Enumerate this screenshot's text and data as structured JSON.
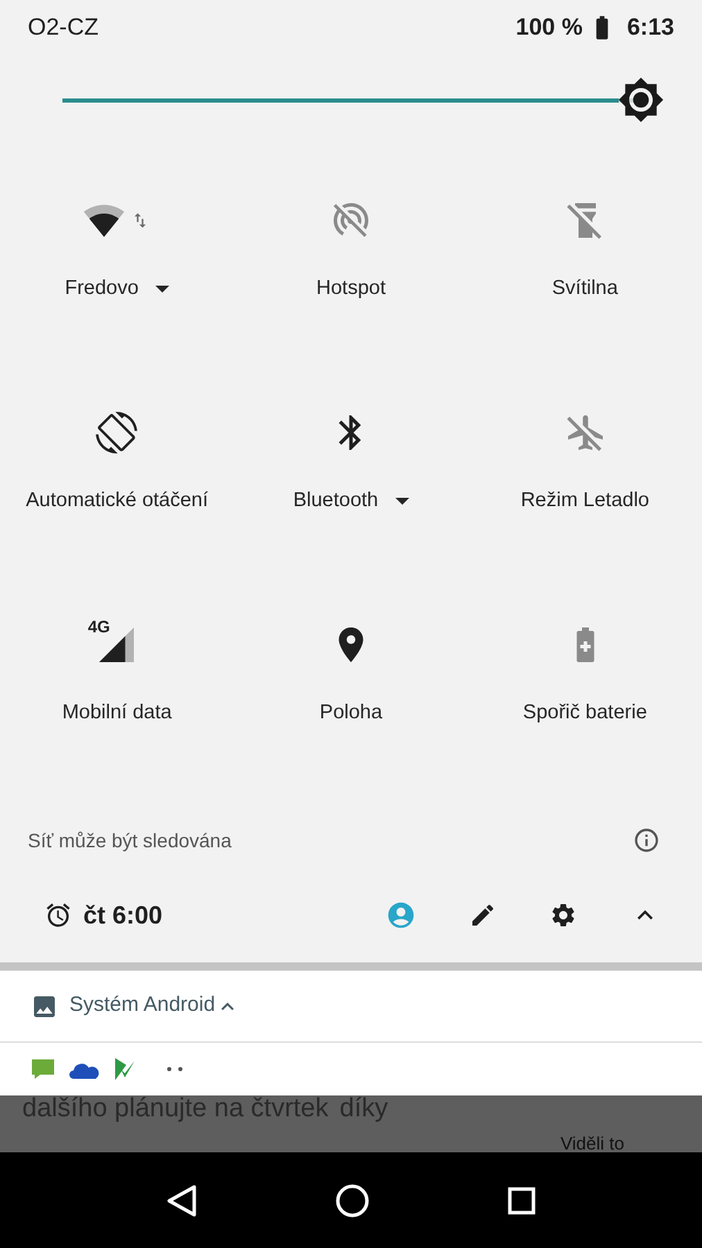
{
  "status_bar": {
    "carrier": "O2-CZ",
    "battery": "100 %",
    "time": "6:13"
  },
  "brightness": {
    "level": 1
  },
  "tiles": [
    {
      "kind": "wifi",
      "label": "Fredovo",
      "on": true,
      "dropdown": true
    },
    {
      "kind": "hotspot",
      "label": "Hotspot",
      "on": false,
      "dropdown": false
    },
    {
      "kind": "flashlight",
      "label": "Svítilna",
      "on": false,
      "dropdown": false
    },
    {
      "kind": "rotation",
      "label": "Automatické otáčení",
      "on": true,
      "dropdown": false
    },
    {
      "kind": "bluetooth",
      "label": "Bluetooth",
      "on": true,
      "dropdown": true
    },
    {
      "kind": "airplane",
      "label": "Režim Letadlo",
      "on": false,
      "dropdown": false
    },
    {
      "kind": "mobile_data",
      "label": "Mobilní data",
      "on": true,
      "dropdown": false,
      "badge": "4G"
    },
    {
      "kind": "location",
      "label": "Poloha",
      "on": true,
      "dropdown": false
    },
    {
      "kind": "battery_saver",
      "label": "Spořič baterie",
      "on": false,
      "dropdown": false
    }
  ],
  "network_notice": "Síť může být sledována",
  "footer": {
    "alarm": "čt 6:00"
  },
  "notification": {
    "app": "Systém Android",
    "expanded": true
  },
  "background_app": {
    "message": "dalšího plánujte na čtvrtek",
    "message_end": "díky",
    "seen": "Viděli to"
  }
}
